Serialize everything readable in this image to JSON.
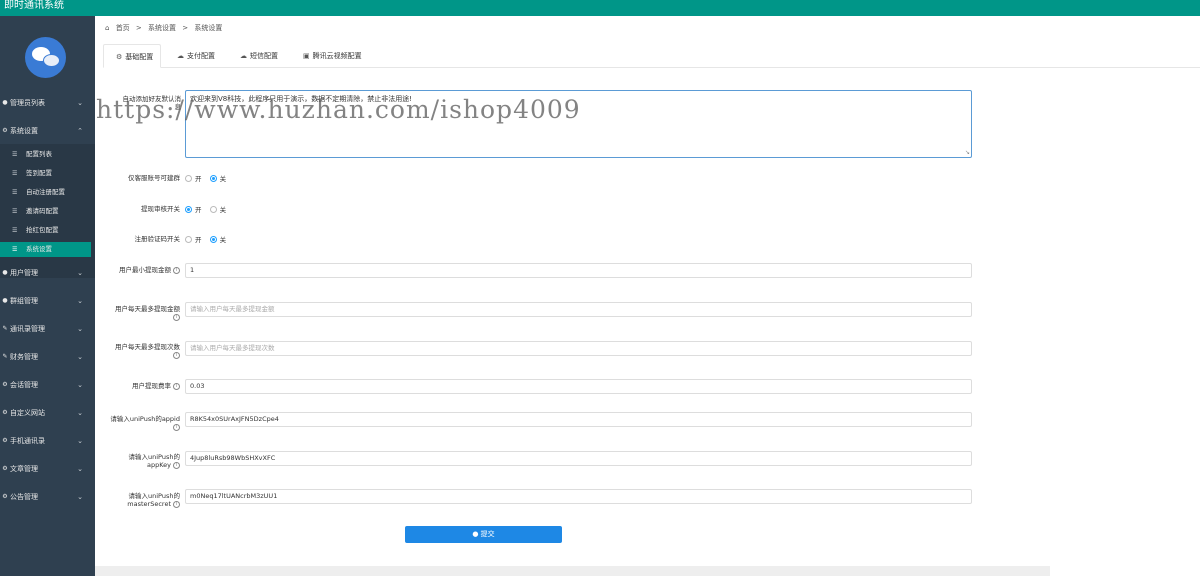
{
  "app": {
    "title": "即时通讯系统"
  },
  "colors": {
    "accent": "#009688",
    "sidebar": "#2f4050",
    "primary_button": "#1e88e5",
    "radio_on": "#1e9fff"
  },
  "sidebar": {
    "logo_icon": "chat-bubbles-logo",
    "items": [
      {
        "label": "管理员列表",
        "icon": "user-icon"
      },
      {
        "label": "系统设置",
        "icon": "gear-icon",
        "expanded": true
      },
      {
        "label": "用户管理",
        "icon": "user-icon"
      },
      {
        "label": "群组管理",
        "icon": "users-icon"
      },
      {
        "label": "通讯录管理",
        "icon": "edit-icon"
      },
      {
        "label": "财务管理",
        "icon": "edit-icon"
      },
      {
        "label": "会话管理",
        "icon": "gear-icon"
      },
      {
        "label": "自定义网站",
        "icon": "gear-icon"
      },
      {
        "label": "手机通讯录",
        "icon": "gear-icon"
      },
      {
        "label": "文章管理",
        "icon": "gear-icon"
      },
      {
        "label": "公告管理",
        "icon": "gear-icon"
      }
    ],
    "sub_items": [
      {
        "label": "配置列表"
      },
      {
        "label": "签到配置"
      },
      {
        "label": "自动注册配置"
      },
      {
        "label": "邀请码配置"
      },
      {
        "label": "抢红包配置"
      },
      {
        "label": "系统设置",
        "active": true
      }
    ]
  },
  "breadcrumb": {
    "home": "首页",
    "sep": ">",
    "level1": "系统设置",
    "level2": "系统设置"
  },
  "tabs": [
    {
      "label": "基础配置",
      "icon": "gear-icon",
      "active": true
    },
    {
      "label": "支付配置",
      "icon": "cloud-icon"
    },
    {
      "label": "短信配置",
      "icon": "cloud-icon"
    },
    {
      "label": "腾讯云视频配置",
      "icon": "cube-icon"
    }
  ],
  "watermark": "https://www.huzhan.com/ishop4009",
  "form": {
    "auto_add_friend": {
      "label": "自动添加好友默认消息",
      "value": "欢迎来到V8科技，此程序只用于演示，数据不定期清除，禁止非法用途!"
    },
    "cs_only_group": {
      "label": "仅客服账号可建群",
      "options": [
        "开",
        "关"
      ],
      "selected": "关"
    },
    "withdraw_audit": {
      "label": "提现审核开关",
      "options": [
        "开",
        "关"
      ],
      "selected": "开"
    },
    "register_code": {
      "label": "注册验证码开关",
      "options": [
        "开",
        "关"
      ],
      "selected": "关"
    },
    "min_withdraw": {
      "label": "用户最小提现金额",
      "value": "1"
    },
    "max_withdraw_amount": {
      "label": "用户每天最多提现金额",
      "placeholder": "请输入用户每天最多提现金额"
    },
    "max_withdraw_times": {
      "label": "用户每天最多提现次数",
      "placeholder": "请输入用户每天最多提现次数"
    },
    "withdraw_rate": {
      "label": "用户提现费率",
      "value": "0.03"
    },
    "unipush_appid": {
      "label": "请输入uniPush的appid",
      "value": "R8K54x0SUrAxJFN5DzCpe4"
    },
    "unipush_appkey": {
      "label": "请输入uniPush的appKey",
      "value": "4Jup8luRsb98WbSHXvXFC"
    },
    "unipush_secret": {
      "label": "请输入uniPush的masterSecret",
      "value": "m0Neq17ltUANcrbM3zUU1"
    },
    "submit_label": "提交"
  }
}
